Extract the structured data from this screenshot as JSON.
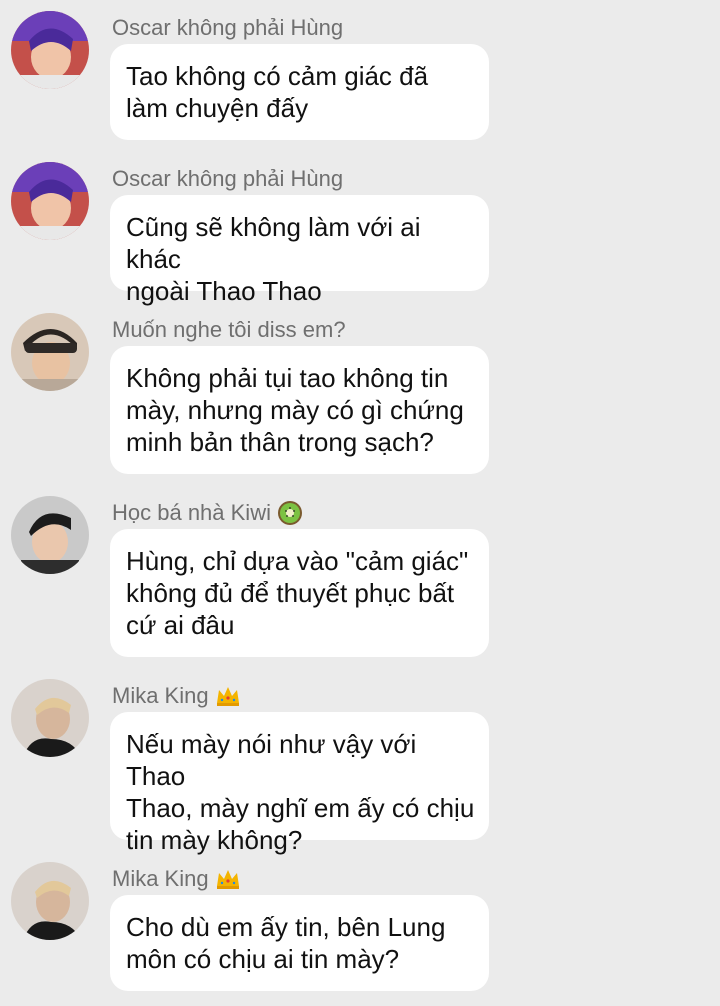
{
  "messages": [
    {
      "sender": "Oscar không phải Hùng",
      "badge": null,
      "avatar": "avatar-oscar",
      "text": "Tao không có cảm giác đã\nlàm chuyện đấy"
    },
    {
      "sender": "Oscar không phải Hùng",
      "badge": null,
      "avatar": "avatar-oscar",
      "text": "Cũng sẽ không làm với ai khác\nngoài Thao Thao"
    },
    {
      "sender": "Muốn nghe tôi diss em?",
      "badge": null,
      "avatar": "avatar-beanie",
      "text": "Không phải tụi tao không tin\nmày, nhưng mày có gì chứng\nminh bản thân trong sạch?"
    },
    {
      "sender": "Học bá nhà Kiwi",
      "badge": "kiwi-icon",
      "avatar": "avatar-kiwi",
      "text": "Hùng, chỉ dựa vào \"cảm giác\"\nkhông đủ để thuyết phục bất\ncứ ai đâu"
    },
    {
      "sender": "Mika King",
      "badge": "crown-icon",
      "avatar": "avatar-mika",
      "text": "Nếu mày nói như vậy với Thao\nThao, mày nghĩ em ấy có chịu\ntin mày không?"
    },
    {
      "sender": "Mika King",
      "badge": "crown-icon",
      "avatar": "avatar-mika",
      "text": "Cho dù em ấy tin, bên Lung\nmôn có chịu ai tin mày?"
    }
  ],
  "colors": {
    "background": "#ebebeb",
    "bubble": "#ffffff",
    "sender_text": "#6f6f6f",
    "message_text": "#111111"
  }
}
